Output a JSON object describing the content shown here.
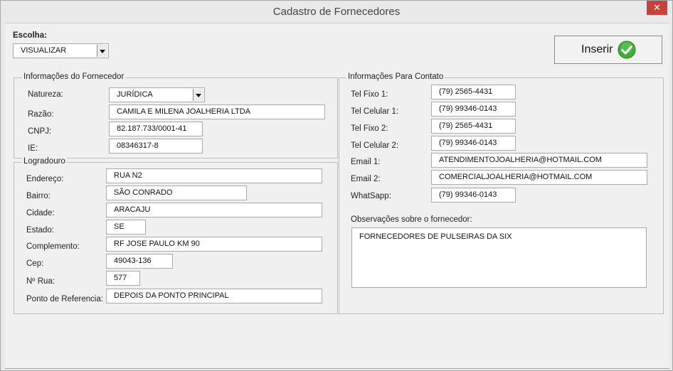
{
  "window": {
    "title": "Cadastro de Fornecedores",
    "close_glyph": "✕"
  },
  "escolha": {
    "label": "Escolha:",
    "value": "VISUALIZAR"
  },
  "inserir": {
    "label": "Inserir",
    "icon": "check-icon"
  },
  "fornecedor": {
    "title": "Informações do Fornecedor",
    "natureza_label": "Natureza:",
    "natureza_value": "JURÍDICA",
    "razao_label": "Razão:",
    "razao_value": "CAMILA E MILENA JOALHERIA LTDA",
    "cnpj_label": "CNPJ:",
    "cnpj_value": "82.187.733/0001-41",
    "ie_label": "IE:",
    "ie_value": "08346317-8"
  },
  "logradouro": {
    "title": "Logradouro",
    "endereco_label": "Endereço:",
    "endereco_value": "RUA N2",
    "bairro_label": "Bairro:",
    "bairro_value": "SÃO CONRADO",
    "cidade_label": "Cidade:",
    "cidade_value": "ARACAJU",
    "estado_label": "Estado:",
    "estado_value": "SE",
    "complemento_label": "Complemento:",
    "complemento_value": "RF JOSE PAULO KM 90",
    "cep_label": "Cep:",
    "cep_value": "49043-136",
    "numero_label": "Nº Rua:",
    "numero_value": "577",
    "referencia_label": "Ponto de Referencia:",
    "referencia_value": "DEPOIS DA PONTO PRINCIPAL"
  },
  "contato": {
    "title": "Informações Para Contato",
    "tel_fixo1_label": "Tel Fixo 1:",
    "tel_fixo1_value": "(79) 2565-4431",
    "tel_cel1_label": "Tel Celular 1:",
    "tel_cel1_value": "(79) 99346-0143",
    "tel_fixo2_label": "Tel Fixo 2:",
    "tel_fixo2_value": "(79) 2565-4431",
    "tel_cel2_label": "Tel Celular 2:",
    "tel_cel2_value": "(79) 99346-0143",
    "email1_label": "Email 1:",
    "email1_value": "ATENDIMENTOJOALHERIA@HOTMAIL.COM",
    "email2_label": "Email 2:",
    "email2_value": "COMERCIALJOALHERIA@HOTMAIL.COM",
    "whatsapp_label": "WhatSapp:",
    "whatsapp_value": "(79) 99346-0143",
    "obs_label": "Observações sobre o fornecedor:",
    "obs_value": "FORNECEDORES DE PULSEIRAS DA SIX"
  },
  "colors": {
    "close_button": "#c7433a",
    "check_green": "#3fae3a"
  }
}
